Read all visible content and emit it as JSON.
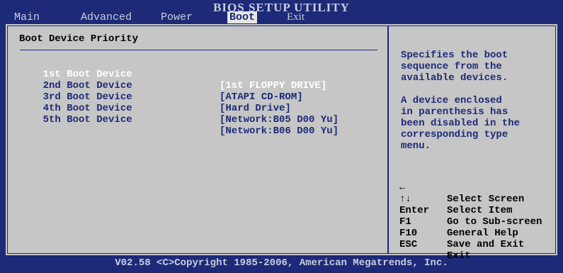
{
  "header": {
    "title": "BIOS SETUP UTILITY",
    "tabs": [
      {
        "label": "Main"
      },
      {
        "label": "Advanced"
      },
      {
        "label": "Power"
      },
      {
        "label": "Boot"
      },
      {
        "label": "Exit"
      }
    ]
  },
  "section": {
    "title": "Boot Device Priority"
  },
  "boot_devices": [
    {
      "label": "1st Boot Device",
      "value": "[1st FLOPPY DRIVE]"
    },
    {
      "label": "2nd Boot Device",
      "value": "[ATAPI CD-ROM]"
    },
    {
      "label": "3rd Boot Device",
      "value": "[Hard Drive]"
    },
    {
      "label": "4th Boot Device",
      "value": "[Network:B05 D00 Yu]"
    },
    {
      "label": "5th Boot Device",
      "value": "[Network:B06 D00 Yu]"
    }
  ],
  "help": {
    "para1": "Specifies the boot\nsequence from the\navailable devices.",
    "para2": "A device enclosed\nin parenthesis has\nbeen disabled in the\ncorresponding type\nmenu."
  },
  "keys": [
    {
      "key": "←",
      "desc": "Select Screen"
    },
    {
      "key": "↑↓",
      "desc": "Select Item"
    },
    {
      "key": "Enter",
      "desc": "Go to Sub-screen"
    },
    {
      "key": "F1",
      "desc": "General Help"
    },
    {
      "key": "F10",
      "desc": "Save and Exit"
    },
    {
      "key": "ESC",
      "desc": "Exit"
    }
  ],
  "footer": {
    "text": "V02.58 <C>Copyright 1985-2006, American Megatrends, Inc."
  },
  "colors": {
    "background": "#1d2a78",
    "panel": "#c6c6c6",
    "highlight": "#ffffff"
  }
}
